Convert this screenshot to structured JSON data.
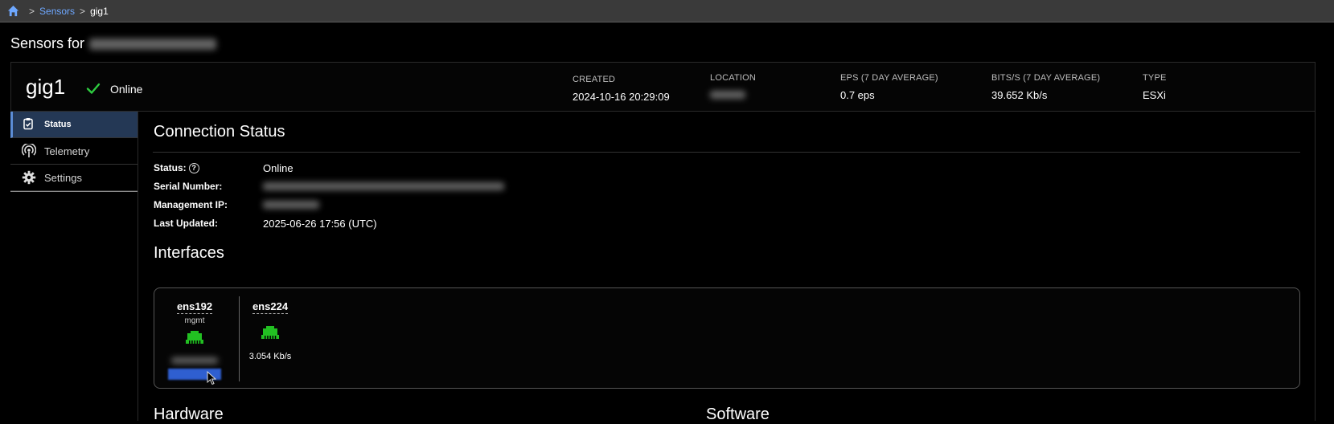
{
  "breadcrumb": {
    "home_icon": "home-icon",
    "separator": ">",
    "items": [
      {
        "label": "Sensors"
      },
      {
        "label": "gig1"
      }
    ]
  },
  "page": {
    "heading_prefix": "Sensors for"
  },
  "sensor": {
    "name": "gig1",
    "status_icon": "check-icon",
    "status": "Online",
    "meta": [
      {
        "label": "CREATED",
        "value": "2024-10-16 20:29:09"
      },
      {
        "label": "LOCATION",
        "value": ""
      },
      {
        "label": "EPS (7 DAY AVERAGE)",
        "value": "0.7 eps"
      },
      {
        "label": "BITS/S (7 DAY AVERAGE)",
        "value": "39.652 Kb/s"
      },
      {
        "label": "TYPE",
        "value": "ESXi"
      }
    ]
  },
  "nav": {
    "items": [
      {
        "label": "Status",
        "icon": "clipboard-check-icon",
        "active": true
      },
      {
        "label": "Telemetry",
        "icon": "antenna-icon",
        "active": false
      },
      {
        "label": "Settings",
        "icon": "gear-icon",
        "active": false
      }
    ]
  },
  "connection": {
    "title": "Connection Status",
    "fields": [
      {
        "label": "Status:",
        "value": "Online"
      },
      {
        "label": "Serial Number:",
        "value": ""
      },
      {
        "label": "Management IP:",
        "value": ""
      },
      {
        "label": "Last Updated:",
        "value": "2025-06-26 17:56 (UTC)"
      }
    ]
  },
  "interfaces": {
    "title": "Interfaces",
    "items": [
      {
        "name": "ens192",
        "role": "mgmt",
        "rate": "",
        "icon": "ethernet-port-icon"
      },
      {
        "name": "ens224",
        "role": "",
        "rate": "3.054 Kb/s",
        "icon": "ethernet-port-icon"
      }
    ]
  },
  "sections": {
    "hardware": "Hardware",
    "software": "Software"
  },
  "colors": {
    "accent": "#5c8dd6",
    "online_green": "#2ecc40",
    "port_green": "#22c022",
    "link": "#6ea8ff"
  }
}
